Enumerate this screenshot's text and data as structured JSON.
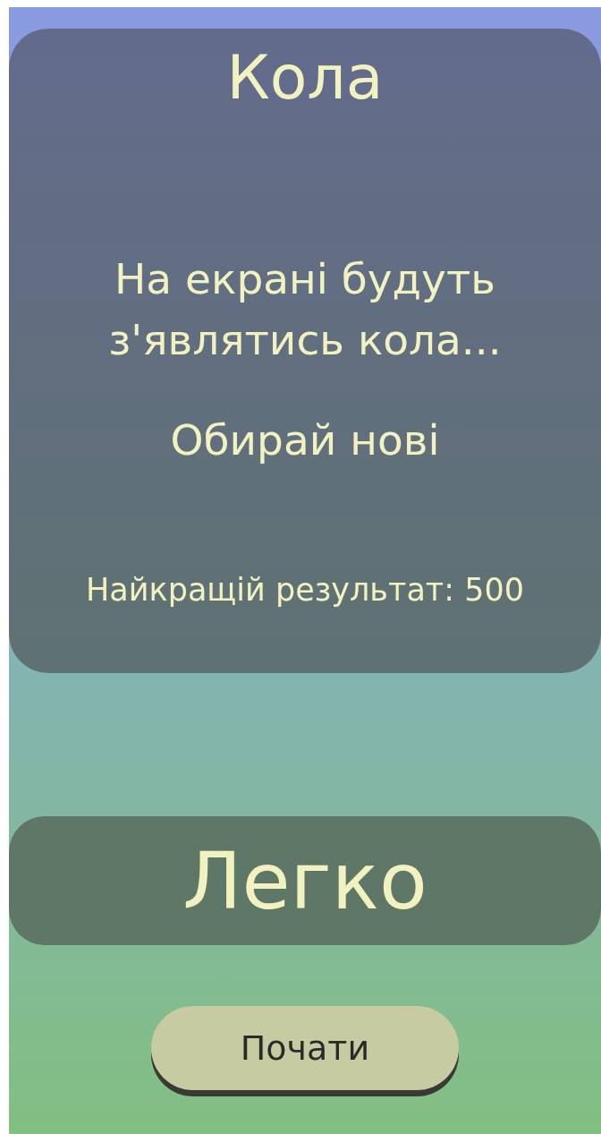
{
  "title": "Кола",
  "description": "На екрані будуть з'являтись кола...",
  "instruction": "Обирай нові",
  "best_score": "Найкращій результат: 500",
  "difficulty": "Легко",
  "start_button": "Почати"
}
